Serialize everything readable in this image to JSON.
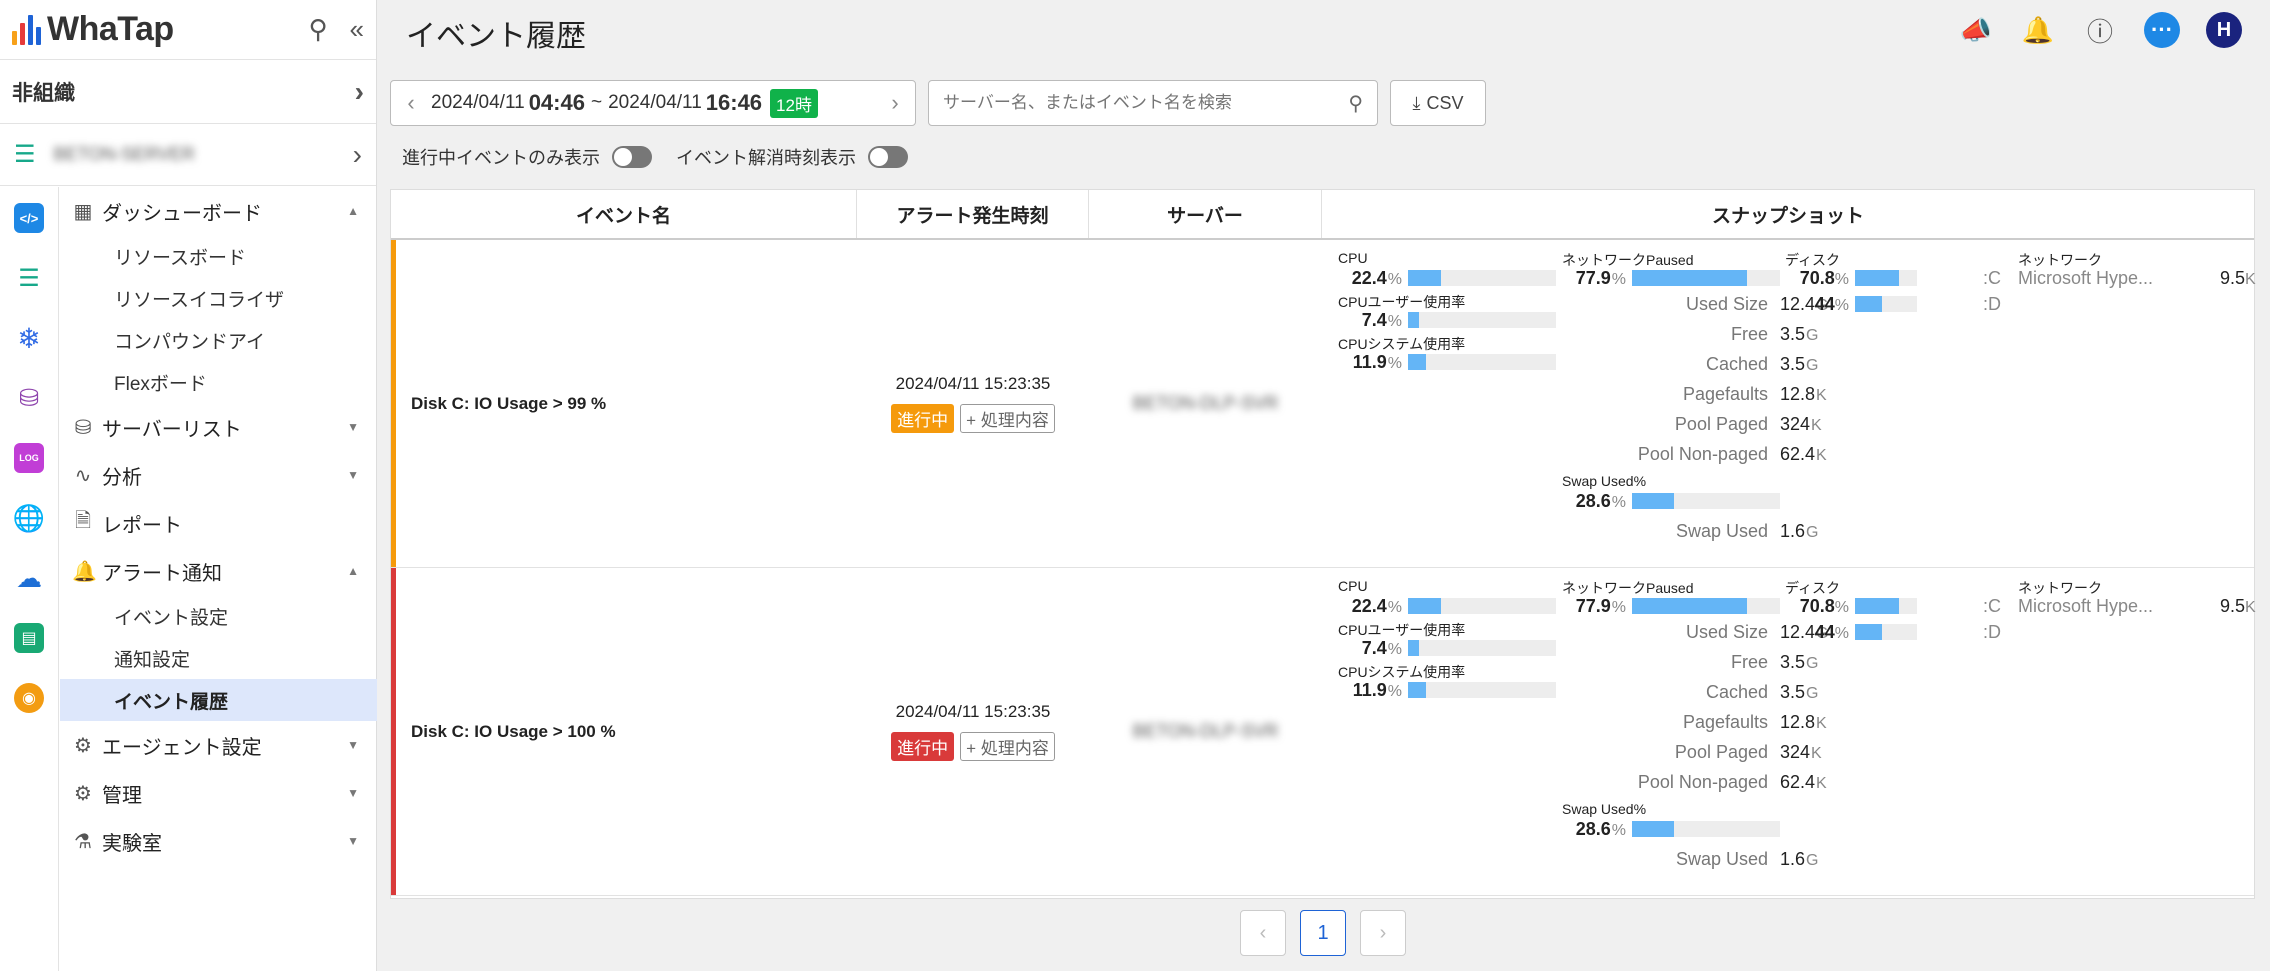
{
  "app": {
    "logo_text": "WhaTap"
  },
  "sidebar": {
    "org_label": "非組織",
    "project_name": "BETON-SERVER",
    "menu": {
      "dashboard": "ダッシューボード",
      "dashboard_sub": [
        "リソースボード",
        "リソースイコライザ",
        "コンパウンドアイ",
        "Flexボード"
      ],
      "server_list": "サーバーリスト",
      "analysis": "分析",
      "report": "レポート",
      "alert": "アラート通知",
      "alert_sub": [
        "イベント設定",
        "通知設定",
        "イベント履歴"
      ],
      "agent": "エージェント設定",
      "manage": "管理",
      "lab": "実験室"
    }
  },
  "header": {
    "title": "イベント履歴",
    "avatar_initial": "H"
  },
  "toolbar": {
    "start_date": "2024/04/11",
    "start_time": "04:46",
    "end_date": "2024/04/11",
    "end_time": "16:46",
    "separator": "~",
    "range": "12時",
    "search_placeholder": "サーバー名、またはイベント名を検索",
    "csv_label": "CSV"
  },
  "toggles": {
    "in_progress_only": "進行中イベントのみ表示",
    "resolved_time": "イベント解消時刻表示"
  },
  "table": {
    "headers": {
      "event_name": "イベント名",
      "alert_time": "アラート発生時刻",
      "server": "サーバー",
      "snapshot": "スナップショット"
    },
    "rows": [
      {
        "event": "Disk C: IO Usage > 99 %",
        "time": "2024/04/11 15:23:35",
        "status": "進行中",
        "status_color": "#f59a0c",
        "stripe_color": "#f59a0c",
        "detail": "+ 処理内容",
        "server": "BETON-DLP-SVR"
      },
      {
        "event": "Disk C: IO Usage > 100 %",
        "time": "2024/04/11 15:23:35",
        "status": "進行中",
        "status_color": "#d93a3a",
        "stripe_color": "#d93a3a",
        "detail": "+ 処理内容",
        "server": "BETON-DLP-SVR"
      }
    ],
    "snapshot": {
      "cpu_label": "CPU",
      "cpu": "22.4",
      "cpu_pct": 22.4,
      "cpu_user_label": "CPUユーザー使用率",
      "cpu_user": "7.4",
      "cpu_user_pct": 7.4,
      "cpu_sys_label": "CPUシステム使用率",
      "cpu_sys": "11.9",
      "cpu_sys_pct": 11.9,
      "net_paused_label": "ネットワークPaused",
      "net_paused": "77.9",
      "net_paused_pct": 77.9,
      "mem_items": [
        {
          "key": "Used Size",
          "value": "12.4",
          "unit": "G"
        },
        {
          "key": "Free",
          "value": "3.5",
          "unit": "G"
        },
        {
          "key": "Cached",
          "value": "3.5",
          "unit": "G"
        },
        {
          "key": "Pagefaults",
          "value": "12.8",
          "unit": "K"
        },
        {
          "key": "Pool Paged",
          "value": "324",
          "unit": "K"
        },
        {
          "key": "Pool Non-paged",
          "value": "62.4",
          "unit": "K"
        }
      ],
      "swap_label": "Swap Used%",
      "swap": "28.6",
      "swap_pct": 28.6,
      "swap_used_key": "Swap Used",
      "swap_used": "1.6",
      "swap_used_unit": "G",
      "disk_label": "ディスク",
      "disk_c": "70.8",
      "disk_c_pct": 70.8,
      "disk_c_name": ":C",
      "disk_d": "44",
      "disk_d_pct": 44,
      "disk_d_name": ":D",
      "network_label": "ネットワーク",
      "nic_name": "Microsoft Hype...",
      "nic_value": "9.5",
      "nic_unit": "K",
      "pct_unit": "%"
    }
  },
  "pagination": {
    "current": "1"
  }
}
